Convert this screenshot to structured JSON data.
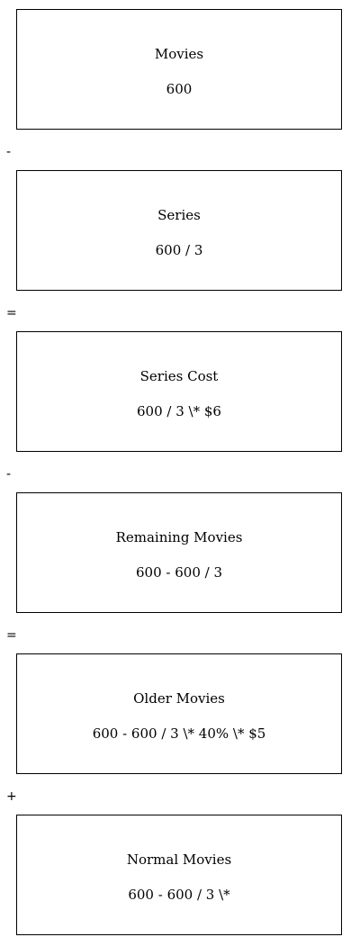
{
  "boxes": [
    {
      "title": "Movies",
      "value": "600"
    },
    {
      "title": "Series",
      "value": "600 / 3"
    },
    {
      "title": "Series Cost",
      "value": "600 / 3 \\* $6"
    },
    {
      "title": "Remaining Movies",
      "value": "600 - 600 / 3"
    },
    {
      "title": "Older Movies",
      "value": "600 - 600 / 3 \\* 40% \\* $5"
    },
    {
      "title": "Normal Movies",
      "value": "600 - 600 / 3 \\*"
    }
  ],
  "operators": [
    "-",
    "=",
    "-",
    "=",
    "+"
  ]
}
